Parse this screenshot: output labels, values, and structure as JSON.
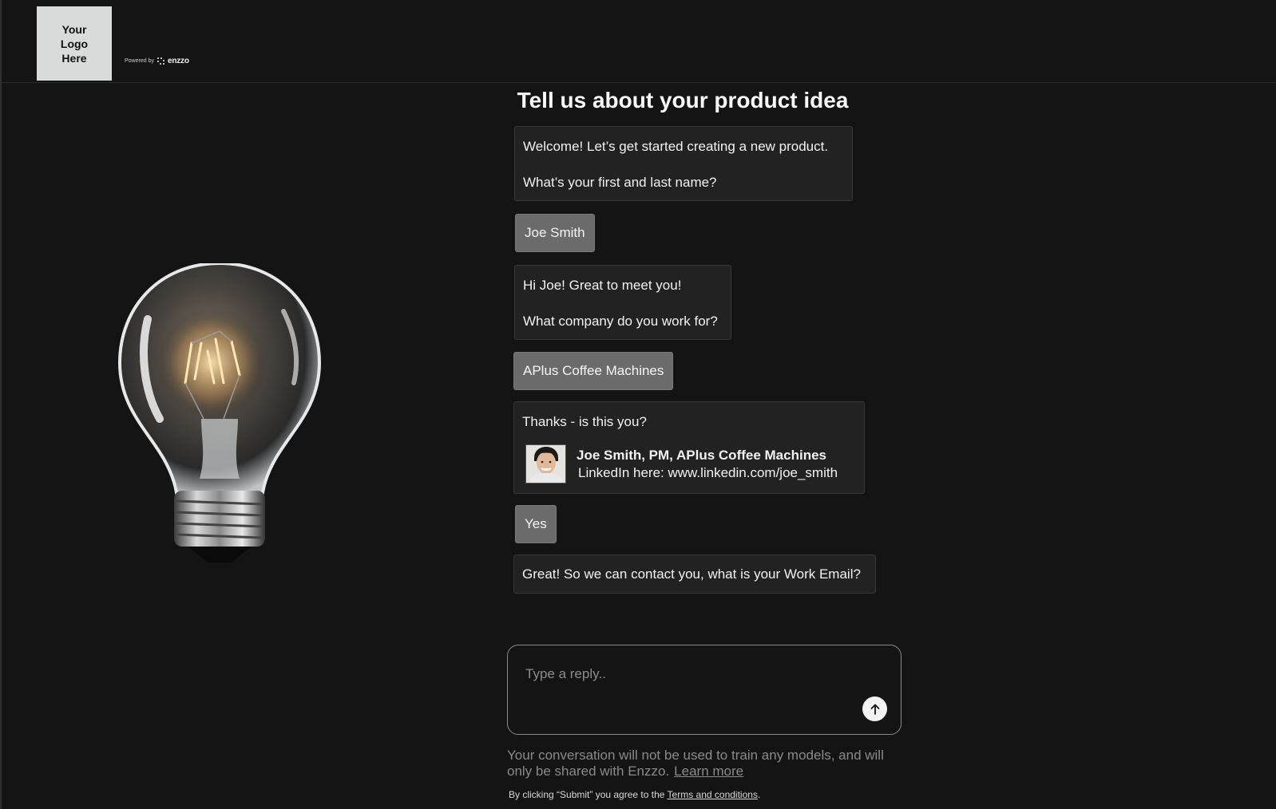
{
  "header": {
    "logo_text": "Your\nLogo\nHere",
    "powered_by": "Powered by",
    "brand": "enzzo"
  },
  "title": "Tell us about your product idea",
  "chat": {
    "bot1_line1": "Welcome! Let’s get started creating a new product.",
    "bot1_line2": "What’s your first and last name?",
    "user1": "Joe Smith",
    "bot2_line1": "Hi Joe! Great to meet you!",
    "bot2_line2": "What company do you work for?",
    "user2": "APlus Coffee Machines",
    "bot3_line1": "Thanks - is this you?",
    "profile_name": "Joe Smith, PM, APlus Coffee Machines",
    "profile_link": "LinkedIn here: www.linkedin.com/joe_smith",
    "user3": "Yes",
    "bot4": "Great! So we can contact you, what is your Work Email?"
  },
  "input": {
    "placeholder": "Type a reply..",
    "send_icon": "arrow-up-icon"
  },
  "footer": {
    "disclaimer": "Your conversation will not be used to train any models, and will only be shared with Enzzo.",
    "learn_more": "Learn more",
    "terms_prefix": "By clicking “Submit” you agree to the",
    "terms_link": "Terms and conditions",
    "terms_suffix": "."
  },
  "colors": {
    "background": "#141414",
    "bubble": "#222222",
    "reply_bubble": "#6b6b6b",
    "text": "#f2f2f2",
    "muted": "#8a8a8a"
  }
}
